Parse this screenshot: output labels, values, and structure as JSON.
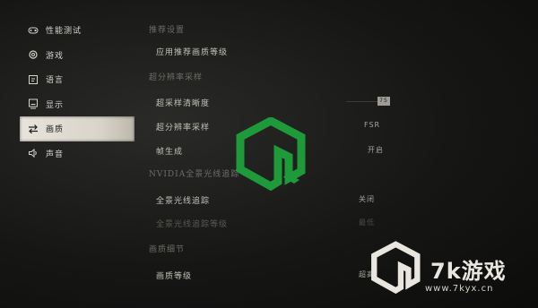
{
  "sidebar": {
    "items": [
      {
        "label": "性能测试",
        "icon": "gamepad-icon",
        "active": false
      },
      {
        "label": "游戏",
        "icon": "gear-icon",
        "active": false
      },
      {
        "label": "语言",
        "icon": "language-icon",
        "active": false
      },
      {
        "label": "显示",
        "icon": "monitor-icon",
        "active": false
      },
      {
        "label": "画质",
        "icon": "swap-arrows-icon",
        "active": true
      },
      {
        "label": "声音",
        "icon": "speaker-icon",
        "active": false
      }
    ]
  },
  "main": {
    "sections": [
      {
        "title": "推荐设置",
        "rows": [
          {
            "label": "应用推荐画质等级",
            "value": ""
          }
        ]
      },
      {
        "title": "超分辨率采样",
        "rows": [
          {
            "label": "超采样清晰度",
            "value": "75"
          },
          {
            "label": "超分辨率采样",
            "value": "FSR"
          },
          {
            "label": "帧生成",
            "value": "开启"
          }
        ]
      },
      {
        "title": "NVIDIA全景光线追踪",
        "rows": [
          {
            "label": "全景光线追踪",
            "value": "关闭"
          },
          {
            "label": "全景光线追踪等级",
            "value": "最低"
          }
        ]
      },
      {
        "title": "画质细节",
        "rows": [
          {
            "label": "画质等级",
            "value": "超高"
          }
        ]
      }
    ]
  },
  "watermark": {
    "brand": "7k游戏",
    "url": "www.7kyx.cn",
    "color": "#1e9a3a"
  }
}
